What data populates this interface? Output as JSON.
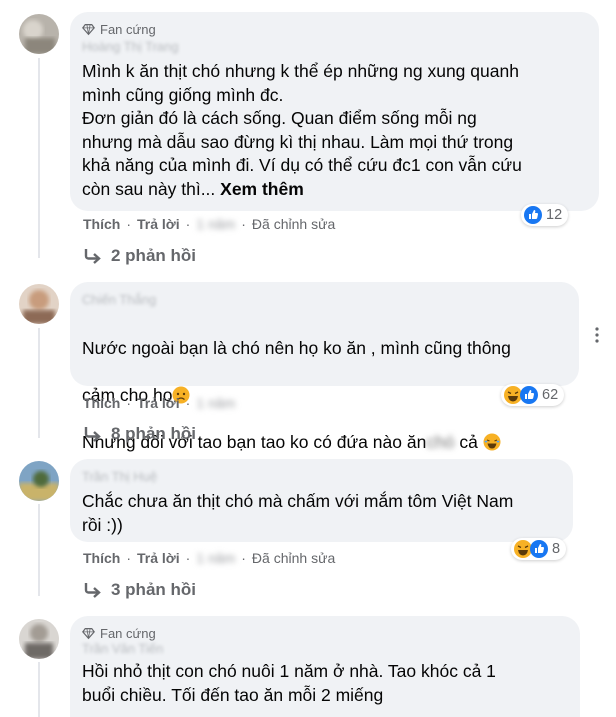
{
  "comments": [
    {
      "badge": "Fan cứng",
      "author": "Hoàng Thị Trang",
      "text": "Mình k ăn thịt chó nhưng k thể ép những ng xung quanh\nmình cũng giống mình đc.\nĐơn giản đó là cách sống. Quan điểm sống mỗi ng\nnhưng mà dẫu sao đừng kì thị nhau. Làm mọi thứ trong\nkhả năng của mình đi. Ví dụ có thể cứu đc1 con vẫn cứu\ncòn sau này thì...",
      "see_more": "Xem thêm",
      "like": "Thích",
      "reply": "Trả lời",
      "time": "1 năm",
      "edited": "Đã chỉnh sửa",
      "reaction_count": "12",
      "replies": "2 phản hồi"
    },
    {
      "author": "Chiến Thắng",
      "text_line1": "Nước ngoài bạn là chó nên họ ko ăn , mình cũng thông",
      "text_line2": "cảm cho họ",
      "text_line3a": "Nhưng đối với tao bạn tao ko có đứa nào ăn",
      "text_line3_blur": "chó",
      "text_line3b": "cả",
      "like": "Thích",
      "reply": "Trả lời",
      "time": "1 năm",
      "reaction_count": "62",
      "replies": "8 phản hồi"
    },
    {
      "author": "Trần Thị Huệ",
      "text": "Chắc chưa ăn thịt chó mà chấm với mắm tôm Việt Nam\nrồi :))",
      "like": "Thích",
      "reply": "Trả lời",
      "time": "1 năm",
      "edited": "Đã chỉnh sửa",
      "reaction_count": "8",
      "replies": "3 phản hồi"
    },
    {
      "badge": "Fan cứng",
      "author": "Trần Văn Tiến",
      "text": "Hồi nhỏ thịt con chó nuôi 1 năm ở nhà. Tao khóc cả 1\nbuổi chiều. Tối đến tao ăn mỗi 2 miếng"
    }
  ],
  "icons": {
    "badge": "diamond-icon",
    "reply_arrow": "reply-arrow-icon",
    "like_reaction": "like-reaction-icon",
    "haha_reaction": "haha-reaction-icon",
    "more": "more-options-icon"
  },
  "colors": {
    "like_blue": "#1877f2",
    "haha_yellow": "#f7b125",
    "bubble": "#f0f2f5",
    "muted": "#65676b"
  }
}
